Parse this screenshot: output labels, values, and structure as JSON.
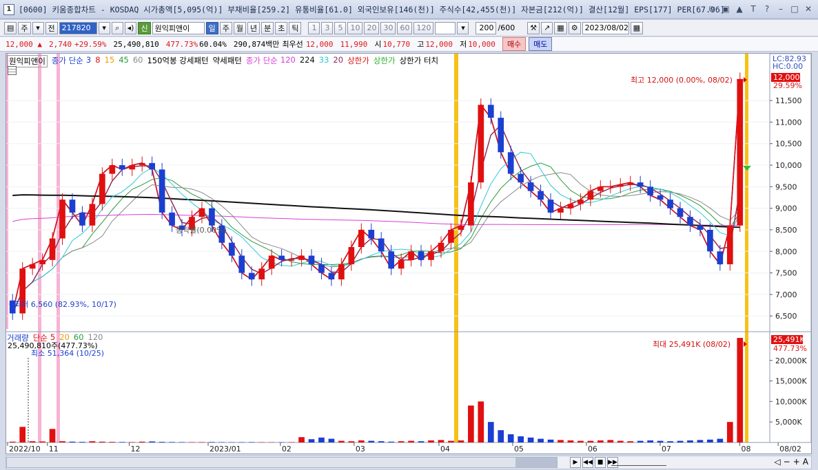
{
  "window": {
    "app_num": "1",
    "title": "[0600] 키움종합차트 - KOSDAQ 시가총액[5,095(억)] 부채비율[259.2] 유통비율[61.0] 외국인보유[146(천)] 주식수[42,455(천)] 자본금[212(억)] 결산[12월] EPS[177] PER[67.96]"
  },
  "toolbar": {
    "type_label": "주",
    "all_label": "전",
    "code": "217820",
    "stock_badge": "신",
    "stock_name": "원익피앤이",
    "periods": [
      "일",
      "주",
      "월",
      "년",
      "분",
      "초",
      "틱"
    ],
    "intervals": [
      "1",
      "3",
      "5",
      "10",
      "20",
      "30",
      "60",
      "120"
    ],
    "count": "200",
    "count_total": "/600",
    "date": "2023/08/02"
  },
  "info": {
    "price": "12,000",
    "change": "2,740",
    "change_rate": "+29.59%",
    "volume": "25,490,810",
    "volume_rate": "477.73%",
    "turnover": "60.04%",
    "amount": "290,874백만",
    "best_ask_label": "최우선",
    "best_ask": "12,000",
    "best_bid": "11,990",
    "open_label": "시",
    "open": "10,770",
    "high_label": "고",
    "high": "12,000",
    "low_label": "저",
    "low": "10,000",
    "buy": "매수",
    "sell": "매도"
  },
  "legend": {
    "name": "원익피앤이",
    "ma_label": "종가 단순",
    "ma_periods": [
      "3",
      "8",
      "15",
      "45",
      "60"
    ],
    "pattern1": "150억봉 강세패턴",
    "pattern2": "약세패턴",
    "ma2_label": "종가 단순",
    "ma2_periods": [
      "120",
      "224",
      "33",
      "20"
    ],
    "limit1": "상한가",
    "limit2": "상한가",
    "limit3": "상한가 터치"
  },
  "volume_legend": {
    "label": "거래량",
    "ma_label": "단순",
    "periods": [
      "5",
      "20",
      "60",
      "120"
    ],
    "current": "25,490,810주(477.73%)",
    "min_note": "최소 51,364 (10/25)",
    "max_note": "최대 25,491K (08/02)",
    "max_box": "25,491K",
    "max_pct": "477.73%"
  },
  "annotations": {
    "high_note": "최고 12,000 (0.00%, 08/02)",
    "low_note": "최저 6,560 (82.93%, 10/17)",
    "mid_note": "등락률(0.00%)",
    "lc": "LC:82.93",
    "hc": "HC:0.00",
    "last_box": "12,000",
    "last_pct": "29.59%"
  },
  "chart_data": [
    {
      "type": "candlestick",
      "title": "원익피앤이",
      "y_ticks": [
        "11,500",
        "11,000",
        "10,500",
        "10,000",
        "9,500",
        "9,000",
        "8,500",
        "8,000",
        "7,500",
        "7,000",
        "6,500"
      ],
      "ylim": [
        6200,
        12300
      ],
      "x_ticks": [
        "2022/10",
        "11",
        "12",
        "2023/01",
        "02",
        "03",
        "04",
        "05",
        "06",
        "07",
        "08",
        "08/02"
      ],
      "close": [
        6560,
        7600,
        7700,
        7800,
        8300,
        9200,
        8900,
        8600,
        9100,
        9800,
        10000,
        9900,
        10000,
        10050,
        9900,
        8900,
        8600,
        8500,
        8800,
        9000,
        8600,
        8200,
        7900,
        7500,
        7350,
        7600,
        7900,
        7800,
        7800,
        7900,
        7700,
        7500,
        7350,
        7700,
        8100,
        8500,
        8300,
        8000,
        7600,
        7800,
        8000,
        7800,
        8000,
        8200,
        8500,
        8600,
        9600,
        11400,
        11100,
        10300,
        9800,
        9600,
        9400,
        9200,
        8900,
        9000,
        9100,
        9200,
        9400,
        9500,
        9500,
        9550,
        9600,
        9500,
        9300,
        9200,
        9000,
        8800,
        8600,
        8500,
        8000,
        7700,
        8600,
        12000
      ],
      "ma_series": [
        {
          "name": "3",
          "color": "#1b3fd1"
        },
        {
          "name": "8",
          "color": "#e01010"
        },
        {
          "name": "15",
          "color": "#e8a000"
        },
        {
          "name": "45",
          "color": "#2b9a3a"
        },
        {
          "name": "60",
          "color": "#888888"
        },
        {
          "name": "120",
          "color": "#d63fd6"
        },
        {
          "name": "224",
          "color": "#111111"
        },
        {
          "name": "33",
          "color": "#30c8d8"
        },
        {
          "name": "20",
          "color": "#8b2a6a"
        }
      ]
    },
    {
      "type": "bar",
      "title": "거래량",
      "y_ticks": [
        "20,000K",
        "15,000K",
        "10,000K",
        "5,000K"
      ],
      "ylim": [
        0,
        26000
      ],
      "values": [
        200,
        3800,
        300,
        250,
        3300,
        300,
        200,
        150,
        300,
        200,
        150,
        120,
        100,
        200,
        250,
        150,
        120,
        100,
        90,
        100,
        120,
        90,
        80,
        90,
        100,
        80,
        70,
        80,
        90,
        1300,
        800,
        1200,
        900,
        400,
        300,
        500,
        400,
        300,
        200,
        300,
        400,
        300,
        500,
        600,
        400,
        500,
        9000,
        10000,
        5000,
        3000,
        2000,
        1500,
        1200,
        900,
        700,
        600,
        500,
        400,
        400,
        500,
        600,
        400,
        300,
        400,
        500,
        400,
        300,
        400,
        500,
        600,
        700,
        900,
        5000,
        25491
      ]
    }
  ]
}
